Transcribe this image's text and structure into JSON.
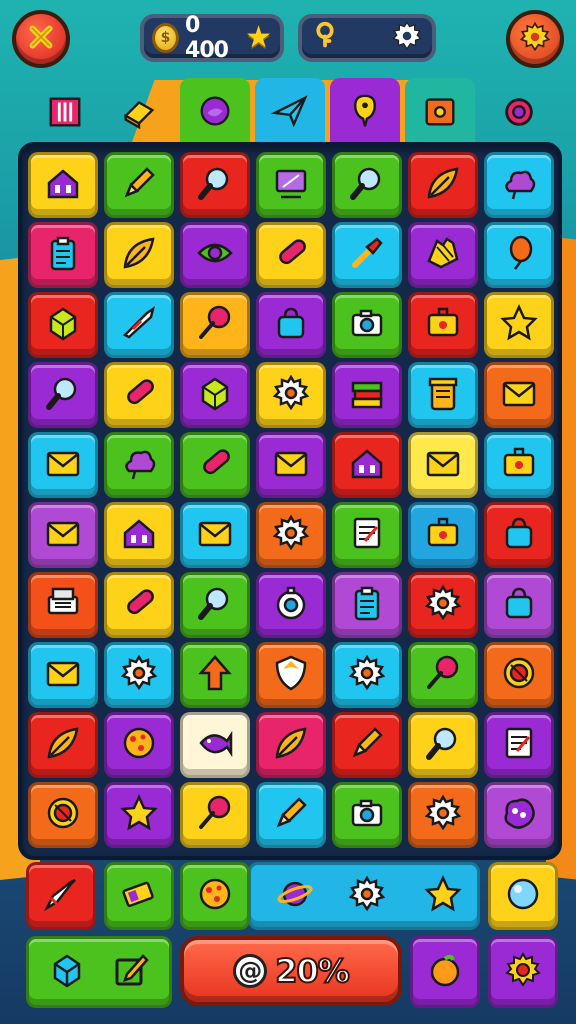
{
  "hud": {
    "coins": "0 400",
    "coin_icon": "coin-icon",
    "star_icon": "star-icon",
    "key_icon": "key-icon",
    "settings_icon": "gear-icon"
  },
  "tabs": [
    {
      "name": "tab-bars",
      "icon": "bars-icon",
      "color": "#f6a21c",
      "raised": false
    },
    {
      "name": "tab-eraser",
      "icon": "eraser-icon",
      "color": "#f6a21c",
      "raised": false
    },
    {
      "name": "tab-orb",
      "icon": "orb-icon",
      "color": "#4cc21e",
      "raised": true
    },
    {
      "name": "tab-plane",
      "icon": "paper-plane-icon",
      "color": "#21b6e6",
      "raised": true
    },
    {
      "name": "tab-pin",
      "icon": "pin-icon",
      "color": "#9a2ad4",
      "raised": true
    },
    {
      "name": "tab-box",
      "icon": "box-icon",
      "color": "#21b6a0",
      "raised": true
    },
    {
      "name": "tab-ring",
      "icon": "ring-icon",
      "color": "#1aa0a8",
      "raised": false
    }
  ],
  "board": {
    "rows": [
      [
        [
          "#ffd21a",
          "house"
        ],
        [
          "#4cc21e",
          "pencil"
        ],
        [
          "#e8251f",
          "magnifier"
        ],
        [
          "#4cc21e",
          "tablet"
        ],
        [
          "#4cc21e",
          "magnifier"
        ],
        [
          "#e8251f",
          "leaf"
        ],
        [
          "#21c6f0",
          "cloud"
        ]
      ],
      [
        [
          "#e8256a",
          "clipboard"
        ],
        [
          "#ffd21a",
          "leaf"
        ],
        [
          "#9a2ad4",
          "eye"
        ],
        [
          "#ffd21a",
          "pill"
        ],
        [
          "#21c6f0",
          "brush"
        ],
        [
          "#9a2ad4",
          "hand"
        ],
        [
          "#21c6f0",
          "balloon"
        ]
      ],
      [
        [
          "#e8251f",
          "cube"
        ],
        [
          "#21c6f0",
          "rocket"
        ],
        [
          "#ffb41a",
          "lollipop"
        ],
        [
          "#9a2ad4",
          "bag"
        ],
        [
          "#4cc21e",
          "camera"
        ],
        [
          "#e8251f",
          "ticket"
        ],
        [
          "#ffd21a",
          "star"
        ]
      ],
      [
        [
          "#9a2ad4",
          "magnifier"
        ],
        [
          "#ffd21a",
          "pill"
        ],
        [
          "#9a2ad4",
          "cube"
        ],
        [
          "#ffd21a",
          "gear"
        ],
        [
          "#9a2ad4",
          "books"
        ],
        [
          "#21c6f0",
          "jar"
        ],
        [
          "#f36a1a",
          "mail"
        ]
      ],
      [
        [
          "#21c6f0",
          "mail"
        ],
        [
          "#4cc21e",
          "cloud"
        ],
        [
          "#4cc21e",
          "pill"
        ],
        [
          "#9a2ad4",
          "mail"
        ],
        [
          "#e8251f",
          "house"
        ],
        [
          "#ffe84a",
          "mail"
        ],
        [
          "#21c6f0",
          "ticket"
        ]
      ],
      [
        [
          "#b04ad4",
          "mail"
        ],
        [
          "#ffd21a",
          "house"
        ],
        [
          "#21c6f0",
          "mail"
        ],
        [
          "#f36a1a",
          "gear"
        ],
        [
          "#4cc21e",
          "note"
        ],
        [
          "#21a6e0",
          "ticket"
        ],
        [
          "#e8251f",
          "bag"
        ]
      ],
      [
        [
          "#f3501a",
          "printer"
        ],
        [
          "#ffd21a",
          "pill"
        ],
        [
          "#4cc21e",
          "magnifier"
        ],
        [
          "#9a2ad4",
          "clock"
        ],
        [
          "#b04ad4",
          "clipboard"
        ],
        [
          "#e8251f",
          "gear"
        ],
        [
          "#b04ad4",
          "bag"
        ]
      ],
      [
        [
          "#21c6f0",
          "mail"
        ],
        [
          "#21c6f0",
          "gear"
        ],
        [
          "#4cc21e",
          "arrow"
        ],
        [
          "#f36a1a",
          "shield"
        ],
        [
          "#21c6f0",
          "gear"
        ],
        [
          "#4cc21e",
          "lollipop"
        ],
        [
          "#f36a1a",
          "disc"
        ]
      ],
      [
        [
          "#e8251f",
          "leaf"
        ],
        [
          "#9a2ad4",
          "cookie"
        ],
        [
          "#fff6d8",
          "fish"
        ],
        [
          "#e8256a",
          "leaf"
        ],
        [
          "#e8251f",
          "pencil"
        ],
        [
          "#ffd21a",
          "magnifier"
        ],
        [
          "#9a2ad4",
          "note"
        ]
      ],
      [
        [
          "#f36a1a",
          "disc"
        ],
        [
          "#9a2ad4",
          "star"
        ],
        [
          "#ffd21a",
          "lollipop"
        ],
        [
          "#21c6f0",
          "pencil"
        ],
        [
          "#4cc21e",
          "camera"
        ],
        [
          "#f36a1a",
          "gear"
        ],
        [
          "#b04ad4",
          "blob"
        ]
      ]
    ]
  },
  "powerups": [
    {
      "name": "powerup-rocket",
      "icon": "rocket-icon",
      "color": "#e8251f"
    },
    {
      "name": "powerup-battery",
      "icon": "battery-icon",
      "color": "#4cc21e"
    },
    {
      "name": "powerup-cookie",
      "icon": "cookie-icon",
      "color": "#4cc21e"
    },
    {
      "name": "powerup-planet",
      "icon": "planet-icon",
      "color": "#21b6e6"
    },
    {
      "name": "powerup-gear",
      "icon": "gear-icon",
      "color": "#21b6e6"
    },
    {
      "name": "powerup-star",
      "icon": "star-icon",
      "color": "#21b6e6"
    },
    {
      "name": "powerup-orb",
      "icon": "orb-icon",
      "color": "#ffd21a"
    }
  ],
  "bottom": {
    "left_icons": [
      "cube-icon",
      "edit-icon"
    ],
    "play_label": "20%",
    "play_prefix": "@",
    "right_icons": [
      "orange-icon",
      "gear-icon"
    ]
  }
}
